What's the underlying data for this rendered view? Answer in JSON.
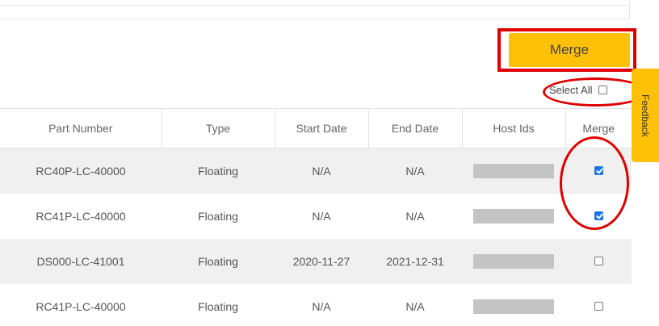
{
  "toolbar": {
    "merge_label": "Merge",
    "select_all_label": "Select All",
    "select_all_checked": false
  },
  "feedback": {
    "label": "Feedback"
  },
  "table": {
    "columns": [
      "Part Number",
      "Type",
      "Start Date",
      "End Date",
      "Host Ids",
      "Merge"
    ],
    "rows": [
      {
        "part_number": "RC40P-LC-40000",
        "type": "Floating",
        "start_date": "N/A",
        "end_date": "N/A",
        "merge": true
      },
      {
        "part_number": "RC41P-LC-40000",
        "type": "Floating",
        "start_date": "N/A",
        "end_date": "N/A",
        "merge": true
      },
      {
        "part_number": "DS000-LC-41001",
        "type": "Floating",
        "start_date": "2020-11-27",
        "end_date": "2021-12-31",
        "merge": false
      },
      {
        "part_number": "RC41P-LC-40000",
        "type": "Floating",
        "start_date": "N/A",
        "end_date": "N/A",
        "merge": false
      }
    ]
  },
  "colors": {
    "accent": "#ffc107",
    "highlight": "#e00000",
    "checkbox_checked": "#1a73e8",
    "row_shade": "#f0f0f0",
    "host_redaction": "#c4c4c4"
  }
}
